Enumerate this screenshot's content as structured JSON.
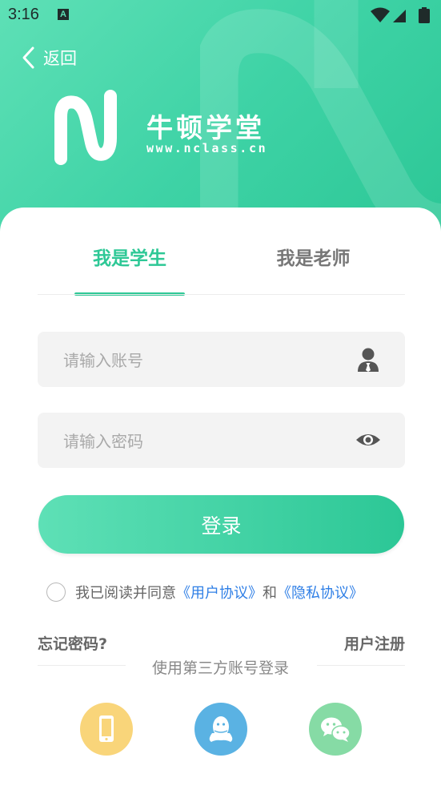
{
  "status_bar": {
    "time": "3:16",
    "notification_icon": "A"
  },
  "header": {
    "back_label": "返回",
    "brand_name": "牛顿学堂",
    "brand_url": "www.nclass.cn"
  },
  "tabs": [
    {
      "label": "我是学生",
      "active": true
    },
    {
      "label": "我是老师",
      "active": false
    }
  ],
  "form": {
    "account_placeholder": "请输入账号",
    "password_placeholder": "请输入密码",
    "login_label": "登录"
  },
  "agreement": {
    "prefix": "我已阅读并同意",
    "user_agreement": "《用户协议》",
    "conjunction": "和",
    "privacy_agreement": "《隐私协议》"
  },
  "links": {
    "forgot_password": "忘记密码?",
    "register": "用户注册"
  },
  "third_party": {
    "label": "使用第三方账号登录",
    "options": [
      {
        "icon": "phone-icon",
        "color": "#f9d57a"
      },
      {
        "icon": "qq-icon",
        "color": "#5ab2e3"
      },
      {
        "icon": "wechat-icon",
        "color": "#86dba5"
      }
    ]
  },
  "colors": {
    "accent": "#2ec896",
    "link": "#2f7fe6"
  }
}
